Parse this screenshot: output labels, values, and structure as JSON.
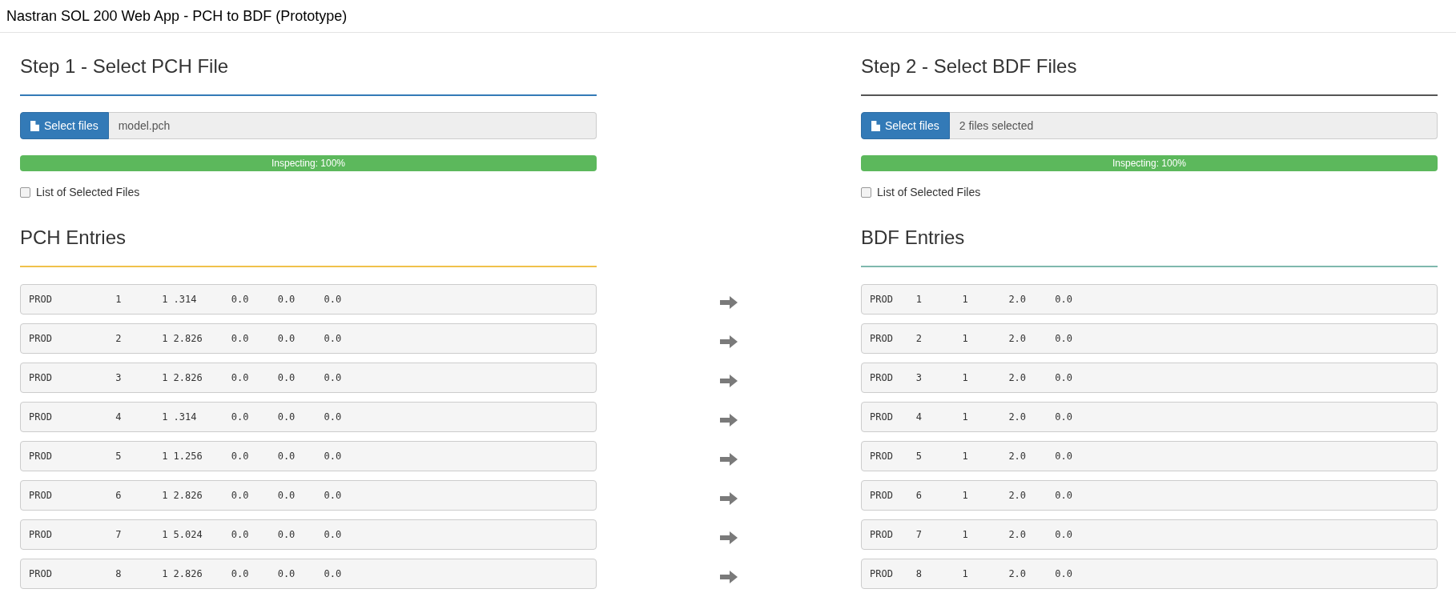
{
  "window": {
    "title": "Nastran SOL 200 Web App - PCH to BDF (Prototype)"
  },
  "panels": [
    {
      "step": {
        "text": "Step 1 - Select PCH File",
        "color": "#337ab7"
      },
      "button": "Select files",
      "file_field": "model.pch",
      "progress": {
        "label": "Inspecting: 100%",
        "level": 1
      },
      "list_option": {
        "label": "List of Selected Files",
        "checked": false
      },
      "entries_heading": {
        "text": "PCH Entries",
        "color": "#f0c14b"
      }
    },
    {
      "step": {
        "text": "Step 2 - Select BDF Files",
        "color": "#555555"
      },
      "button": "Select files",
      "file_field": "2 files selected",
      "progress": {
        "label": "Inspecting: 100%",
        "level": 1
      },
      "list_option": {
        "label": "List of Selected Files",
        "checked": false
      },
      "entries_heading": {
        "text": "BDF Entries",
        "color": "#7fb8ad"
      }
    }
  ],
  "rows": [
    {
      "pch": "PROD           1       1 .314      0.0     0.0     0.0",
      "bdf": "PROD    1       1       2.0     0.0"
    },
    {
      "pch": "PROD           2       1 2.826     0.0     0.0     0.0",
      "bdf": "PROD    2       1       2.0     0.0"
    },
    {
      "pch": "PROD           3       1 2.826     0.0     0.0     0.0",
      "bdf": "PROD    3       1       2.0     0.0"
    },
    {
      "pch": "PROD           4       1 .314      0.0     0.0     0.0",
      "bdf": "PROD    4       1       2.0     0.0"
    },
    {
      "pch": "PROD           5       1 1.256     0.0     0.0     0.0",
      "bdf": "PROD    5       1       2.0     0.0"
    },
    {
      "pch": "PROD           6       1 2.826     0.0     0.0     0.0",
      "bdf": "PROD    6       1       2.0     0.0"
    },
    {
      "pch": "PROD           7       1 5.024     0.0     0.0     0.0",
      "bdf": "PROD    7       1       2.0     0.0"
    },
    {
      "pch": "PROD           8       1 2.826     0.0     0.0     0.0",
      "bdf": "PROD    8       1       2.0     0.0"
    }
  ]
}
